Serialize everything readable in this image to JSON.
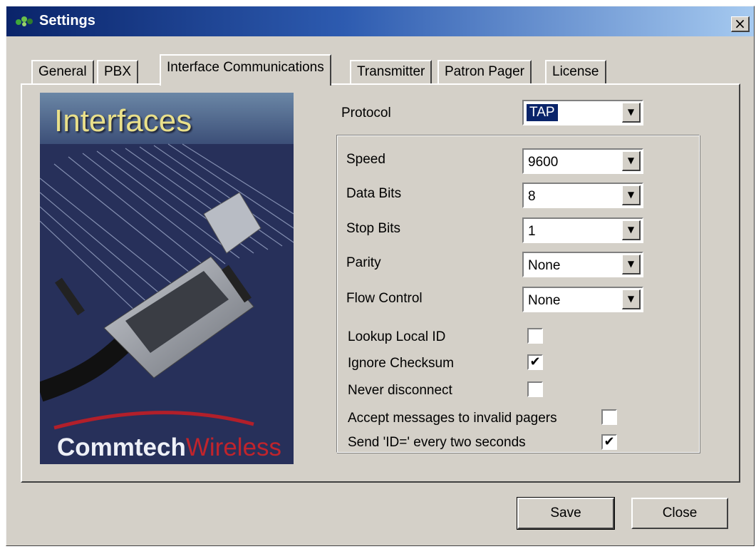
{
  "window": {
    "title": "Settings",
    "close_glyph": "×"
  },
  "tabs": [
    {
      "label": "General"
    },
    {
      "label": "PBX"
    },
    {
      "label": "Interface Communications",
      "active": true
    },
    {
      "label": "Transmitter"
    },
    {
      "label": "Patron Pager"
    },
    {
      "label": "License"
    }
  ],
  "banner": {
    "title": "Interfaces",
    "brand_main": "Commtech",
    "brand_accent": "Wireless",
    "icon": "serial-cable-connector-image"
  },
  "form": {
    "protocol": {
      "label": "Protocol",
      "value": "TAP"
    },
    "speed": {
      "label": "Speed",
      "value": "9600"
    },
    "data_bits": {
      "label": "Data Bits",
      "value": "8"
    },
    "stop_bits": {
      "label": "Stop Bits",
      "value": "1"
    },
    "parity": {
      "label": "Parity",
      "value": "None"
    },
    "flow_control": {
      "label": "Flow Control",
      "value": "None"
    },
    "lookup_local_id": {
      "label": "Lookup Local ID",
      "checked": false
    },
    "ignore_checksum": {
      "label": "Ignore Checksum",
      "checked": true
    },
    "never_disconnect": {
      "label": "Never disconnect",
      "checked": false
    },
    "accept_invalid": {
      "label": "Accept messages to invalid pagers",
      "checked": false
    },
    "send_id": {
      "label": "Send 'ID=' every two seconds",
      "checked": true
    },
    "check_glyph": "✔",
    "dropdown_glyph": "▼"
  },
  "buttons": {
    "save_label": "Save",
    "close_label": "Close"
  },
  "colors": {
    "titlebar_start": "#0a246a",
    "titlebar_end": "#a6caf0",
    "dialog_bg": "#d4d0c8",
    "selection": "#0a246a"
  }
}
